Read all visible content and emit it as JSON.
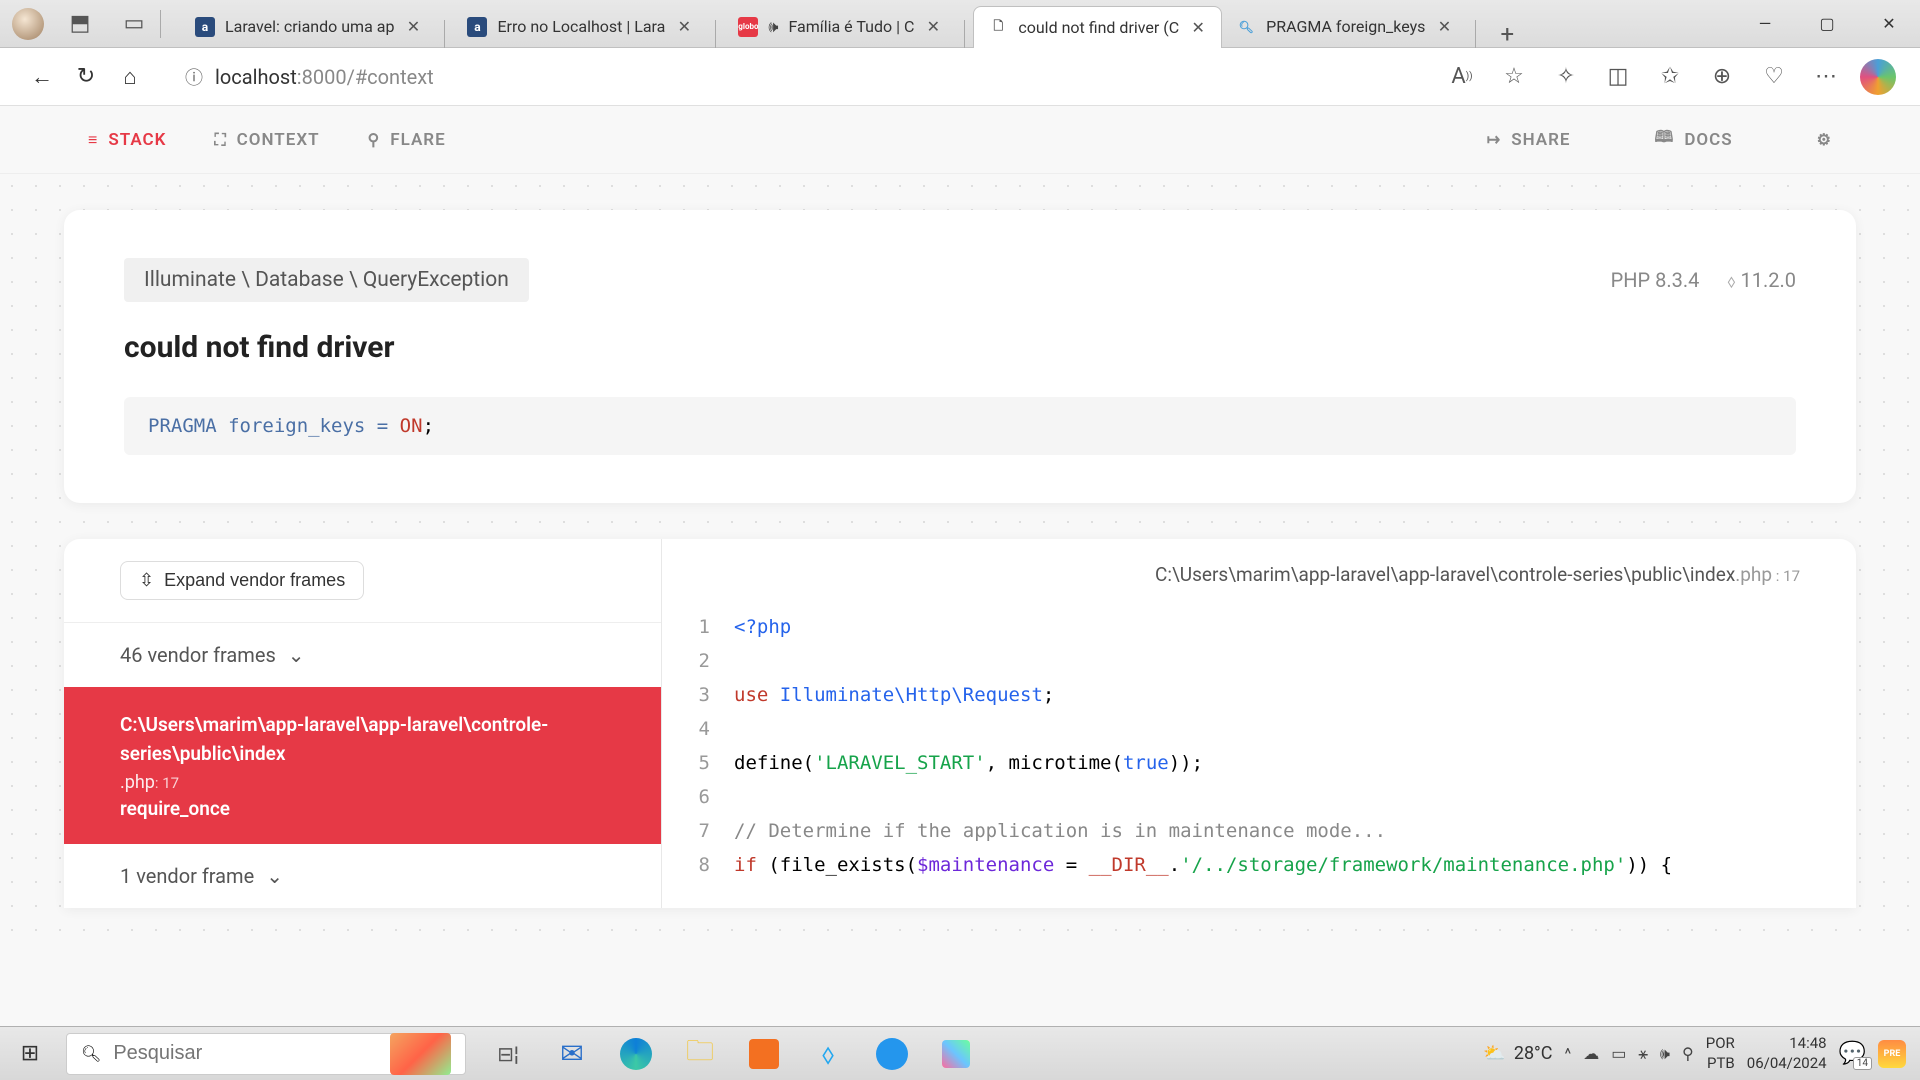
{
  "browser": {
    "tabs": [
      {
        "title": "Laravel: criando uma ap",
        "favicon": "a"
      },
      {
        "title": "Erro no Localhost | Lara",
        "favicon": "a"
      },
      {
        "title": "Família é Tudo | C",
        "favicon": "globo",
        "sound": true
      },
      {
        "title": "could not find driver (C",
        "favicon": "file",
        "active": true
      },
      {
        "title": "PRAGMA foreign_keys",
        "favicon": "search"
      }
    ],
    "url_host": "localhost",
    "url_rest": ":8000/#context"
  },
  "ignition": {
    "nav": {
      "stack": "STACK",
      "context": "CONTEXT",
      "flare": "FLARE",
      "share": "SHARE",
      "docs": "DOCS"
    },
    "exception_class": "Illuminate \\ Database \\ QueryException",
    "php_version": "PHP 8.3.4",
    "laravel_version": "11.2.0",
    "error_title": "could not find driver",
    "sql_pre": "PRAGMA foreign_keys = ",
    "sql_val": "ON",
    "expand_label": "Expand vendor frames",
    "vendor_frames_top": "46 vendor frames",
    "active_frame": {
      "path": "C:\\Users\\marim\\app-laravel\\app-laravel\\controle-series\\public\\index",
      "ext": ".php",
      "line": ": 17",
      "fn": "require_once"
    },
    "vendor_frames_bottom": "1 vendor frame",
    "code_header": {
      "path": "C:\\Users\\marim\\app-laravel\\app-laravel\\controle-series\\public\\index",
      "ext": ".php",
      "line": " : 17"
    }
  },
  "chart_data": null,
  "taskbar": {
    "search_placeholder": "Pesquisar",
    "temp": "28°C",
    "lang1": "POR",
    "lang2": "PTB",
    "time": "14:48",
    "date": "06/04/2024",
    "notif": "14"
  }
}
